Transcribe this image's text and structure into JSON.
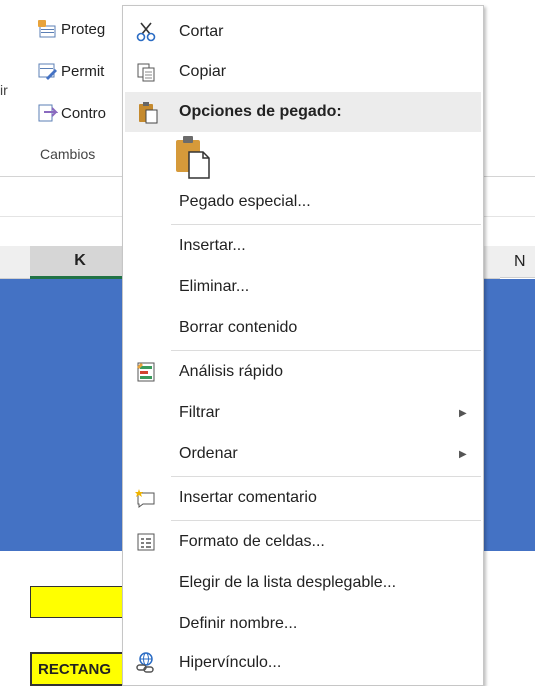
{
  "ribbon": {
    "buttons": [
      {
        "label": "Proteg"
      },
      {
        "label": "Permit"
      },
      {
        "label": "Contro"
      }
    ],
    "cut_text": "ir",
    "group_label": "Cambios"
  },
  "sheet": {
    "col_k": "K",
    "col_n": "N",
    "cell_text": "RECTANG",
    "colors": {
      "fill": "#4472c4",
      "highlight": "#ffff00",
      "selected_header_border": "#217346"
    }
  },
  "menu": {
    "cut": "Cortar",
    "copy": "Copiar",
    "paste_options_header": "Opciones de pegado:",
    "paste_special": "Pegado especial...",
    "insert": "Insertar...",
    "delete": "Eliminar...",
    "clear": "Borrar contenido",
    "quick_analysis": "Análisis rápido",
    "filter": "Filtrar",
    "sort": "Ordenar",
    "insert_comment": "Insertar comentario",
    "format_cells": "Formato de celdas...",
    "pick_dropdown": "Elegir de la lista desplegable...",
    "define_name": "Definir nombre...",
    "hyperlink": "Hipervínculo..."
  },
  "icons": [
    "scissors-icon",
    "copy-icon",
    "clipboard-icon",
    "paste-icon",
    "quick-analysis-icon",
    "submenu-arrow-icon",
    "comment-icon",
    "format-cells-icon",
    "hyperlink-icon"
  ]
}
